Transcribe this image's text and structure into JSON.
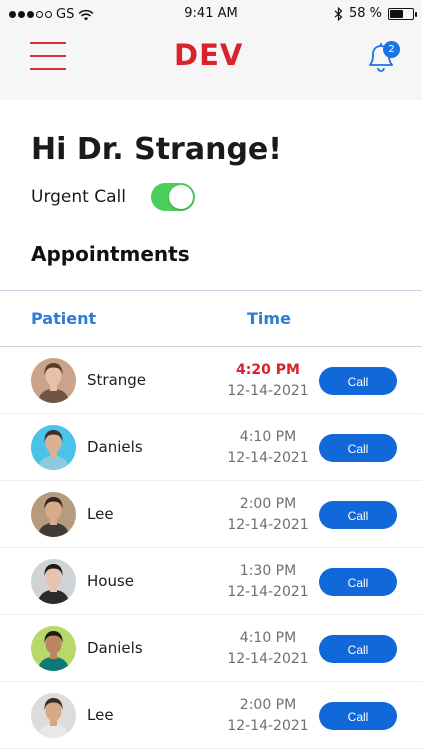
{
  "status_bar": {
    "carrier": "GS",
    "time": "9:41 AM",
    "battery_percent": "58 %",
    "battery_level": 0.58
  },
  "header": {
    "logo_text": "DEV",
    "notification_count": "2",
    "accent_color": "#d8232a",
    "icon_color": "#1a73e8"
  },
  "greeting": "Hi Dr. Strange!",
  "urgent_call": {
    "label": "Urgent Call",
    "enabled": true
  },
  "appointments": {
    "title": "Appointments",
    "columns": {
      "patient": "Patient",
      "time": "Time"
    },
    "rows": [
      {
        "name": "Strange",
        "time": "4:20 PM",
        "date": "12-14-2021",
        "urgent": true,
        "action": "Call"
      },
      {
        "name": "Daniels",
        "time": "4:10 PM",
        "date": "12-14-2021",
        "urgent": false,
        "action": "Call"
      },
      {
        "name": "Lee",
        "time": "2:00 PM",
        "date": "12-14-2021",
        "urgent": false,
        "action": "Call"
      },
      {
        "name": "House",
        "time": "1:30 PM",
        "date": "12-14-2021",
        "urgent": false,
        "action": "Call"
      },
      {
        "name": "Daniels",
        "time": "4:10 PM",
        "date": "12-14-2021",
        "urgent": false,
        "action": "Call"
      },
      {
        "name": "Lee",
        "time": "2:00 PM",
        "date": "12-14-2021",
        "urgent": false,
        "action": "Call"
      }
    ]
  }
}
